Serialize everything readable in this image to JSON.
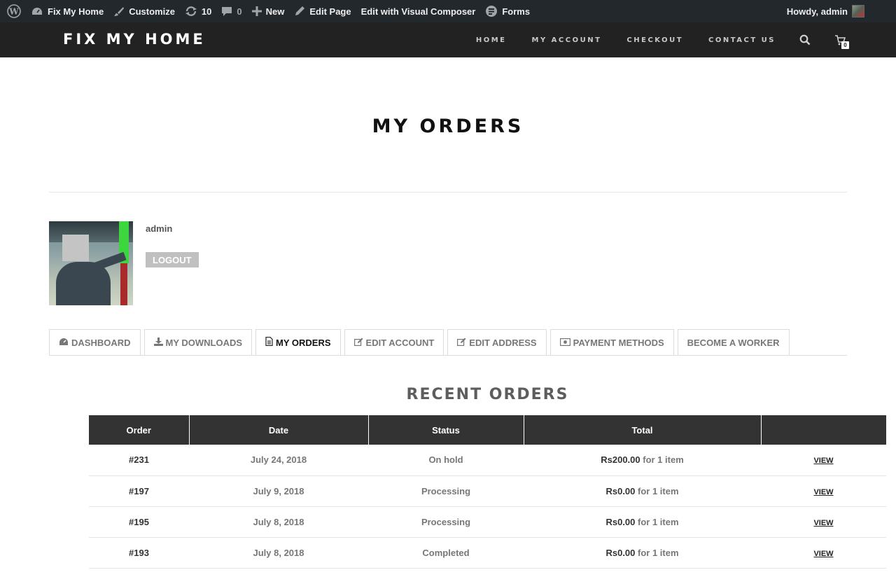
{
  "admin_bar": {
    "site_name": "Fix My Home",
    "customize": "Customize",
    "updates_count": "10",
    "comments_count": "0",
    "new_label": "New",
    "edit_page": "Edit Page",
    "edit_visual_composer": "Edit with Visual Composer",
    "forms": "Forms",
    "greeting": "Howdy, admin"
  },
  "header": {
    "logo": "FIX MY HOME",
    "nav": [
      "HOME",
      "MY ACCOUNT",
      "CHECKOUT",
      "CONTACT US"
    ],
    "cart_count": "0"
  },
  "page": {
    "title": "MY ORDERS"
  },
  "profile": {
    "username": "admin",
    "logout": "LOGOUT"
  },
  "tabs": [
    {
      "label": "DASHBOARD",
      "icon": "dashboard-icon"
    },
    {
      "label": "MY DOWNLOADS",
      "icon": "download-icon"
    },
    {
      "label": "MY ORDERS",
      "icon": "document-icon",
      "active": true
    },
    {
      "label": "EDIT ACCOUNT",
      "icon": "edit-icon"
    },
    {
      "label": "EDIT ADDRESS",
      "icon": "edit-icon"
    },
    {
      "label": "PAYMENT METHODS",
      "icon": "money-icon"
    },
    {
      "label": "BECOME A WORKER",
      "icon": ""
    }
  ],
  "orders": {
    "title": "RECENT ORDERS",
    "columns": [
      "Order",
      "Date",
      "Status",
      "Total",
      ""
    ],
    "rows": [
      {
        "order": "#231",
        "date": "July 24, 2018",
        "status": "On hold",
        "amount": "Rs200.00",
        "items": " for 1 item",
        "action": "VIEW"
      },
      {
        "order": "#197",
        "date": "July 9, 2018",
        "status": "Processing",
        "amount": "Rs0.00",
        "items": " for 1 item",
        "action": "VIEW"
      },
      {
        "order": "#195",
        "date": "July 8, 2018",
        "status": "Processing",
        "amount": "Rs0.00",
        "items": " for 1 item",
        "action": "VIEW"
      },
      {
        "order": "#193",
        "date": "July 8, 2018",
        "status": "Completed",
        "amount": "Rs0.00",
        "items": " for 1 item",
        "action": "VIEW"
      }
    ]
  }
}
